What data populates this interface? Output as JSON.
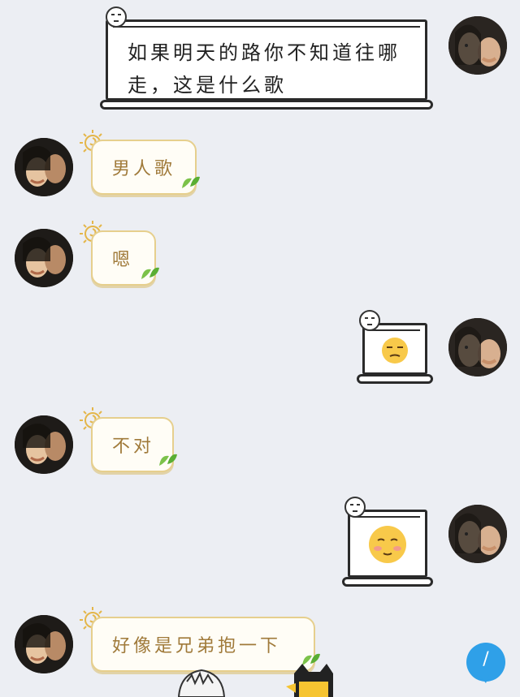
{
  "chat": {
    "messages": [
      {
        "side": "right",
        "text": "如果明天的路你不知道往哪走，这是什么歌"
      },
      {
        "side": "left",
        "text": "男人歌"
      },
      {
        "side": "left",
        "text": "嗯"
      },
      {
        "side": "right",
        "emoji": "unamused-face"
      },
      {
        "side": "left",
        "text": "不对"
      },
      {
        "side": "right",
        "emoji": "blushing-face"
      },
      {
        "side": "left",
        "text": "好像是兄弟抱一下"
      }
    ],
    "line1": "如果明天的路你不知道往哪",
    "line2": "走，这是什么歌",
    "msg2": "男人歌",
    "msg3": "嗯",
    "msg5": "不对",
    "msg7": "好像是兄弟抱一下"
  },
  "fab": {
    "label": "/",
    "icon": "reply-bubble-icon"
  },
  "colors": {
    "background": "#eceef3",
    "bubble_fill": "#fffdf6",
    "bubble_border": "#e6cf8d",
    "bubble_text": "#a07a3a",
    "fab": "#2fa0e8"
  }
}
